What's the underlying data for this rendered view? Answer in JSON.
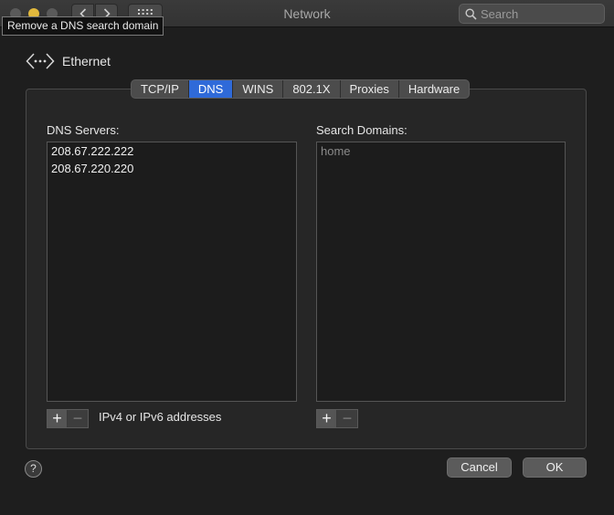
{
  "window": {
    "title": "Network"
  },
  "search": {
    "placeholder": "Search"
  },
  "tooltip": {
    "text": "Remove a DNS search domain"
  },
  "interface": {
    "name": "Ethernet"
  },
  "tabs": [
    {
      "label": "TCP/IP"
    },
    {
      "label": "DNS",
      "active": true
    },
    {
      "label": "WINS"
    },
    {
      "label": "802.1X"
    },
    {
      "label": "Proxies"
    },
    {
      "label": "Hardware"
    }
  ],
  "dns": {
    "label": "DNS Servers:",
    "servers": [
      "208.67.222.222",
      "208.67.220.220"
    ],
    "hint": "IPv4 or IPv6 addresses",
    "add_label": "+",
    "remove_label": "−"
  },
  "search_domains": {
    "label": "Search Domains:",
    "domains": [
      "home"
    ],
    "add_label": "+",
    "remove_label": "−"
  },
  "footer": {
    "help_label": "?",
    "cancel_label": "Cancel",
    "ok_label": "OK"
  },
  "colors": {
    "accent": "#2f6ad9",
    "minimize": "#e2b93d"
  }
}
